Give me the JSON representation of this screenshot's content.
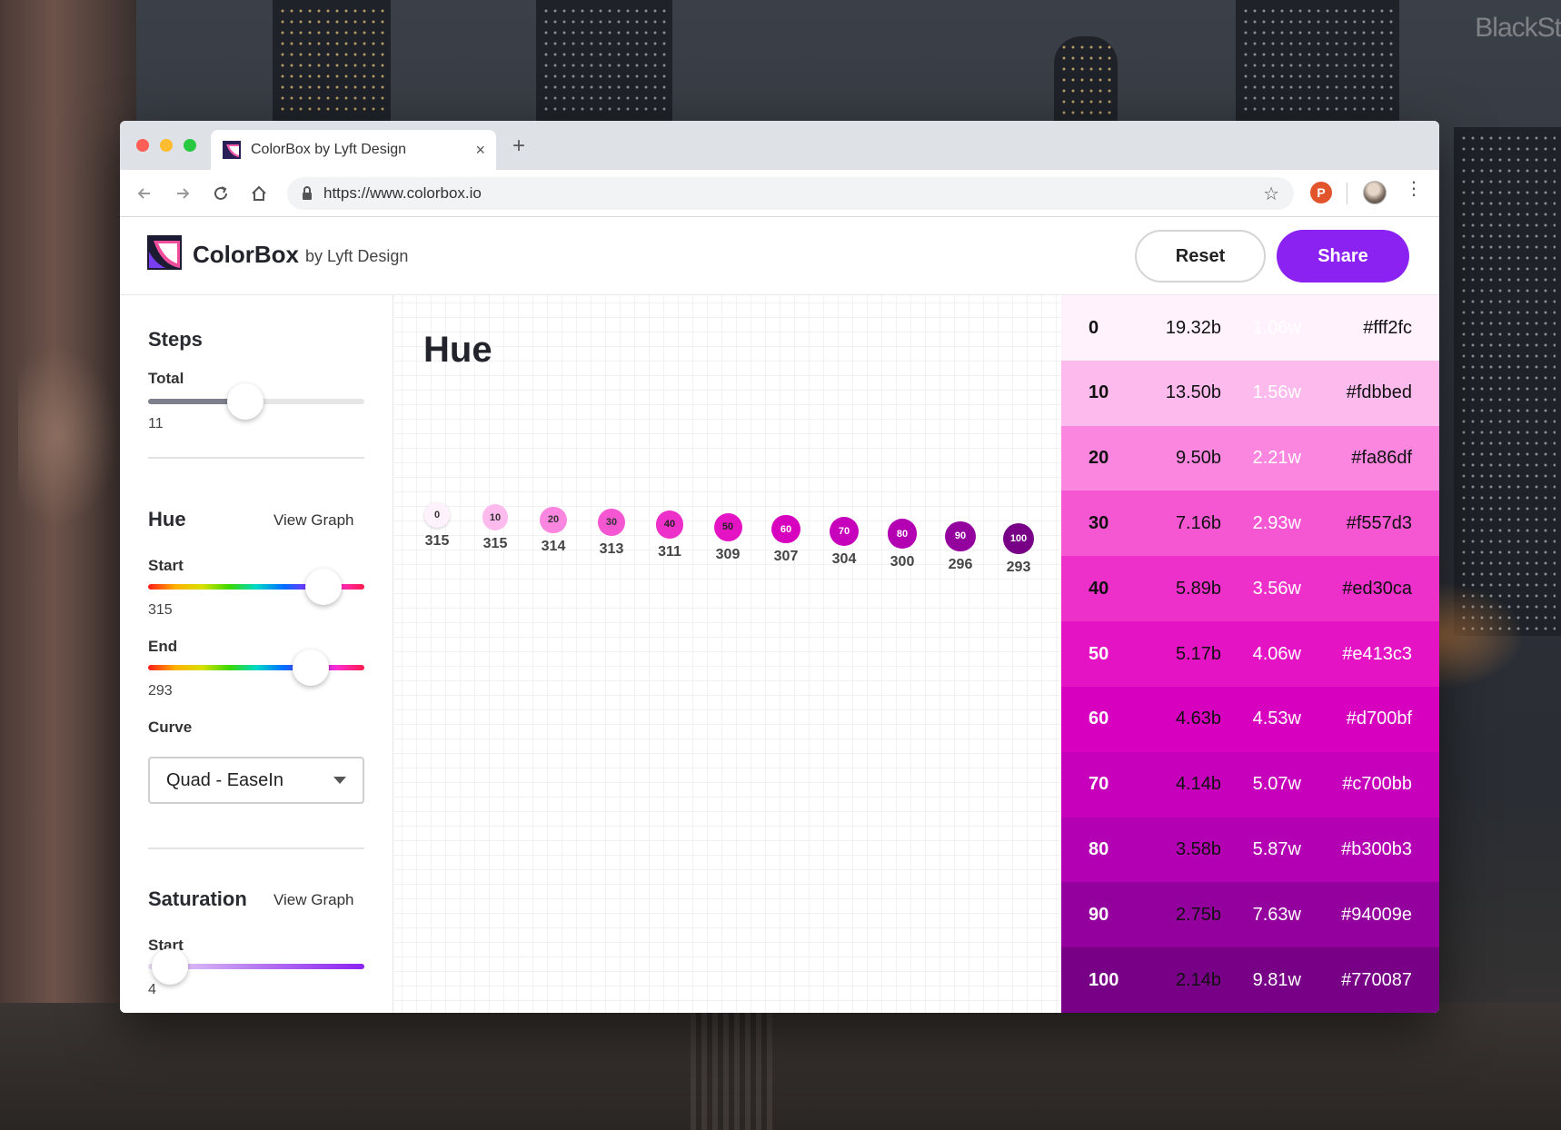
{
  "wallpaper": {
    "watermark": "BlackSt"
  },
  "browser": {
    "tab_title": "ColorBox by Lyft Design",
    "tab_close": "×",
    "new_tab": "+",
    "url": "https://www.colorbox.io",
    "extension_letter": "P"
  },
  "header": {
    "brand": "ColorBox",
    "byline": "by Lyft Design",
    "reset_label": "Reset",
    "share_label": "Share",
    "accent": "#8c22f2"
  },
  "sidebar": {
    "steps": {
      "heading": "Steps",
      "total_label": "Total",
      "total_value": "11",
      "slider_fraction": 0.45
    },
    "hue": {
      "heading": "Hue",
      "view_graph": "View Graph",
      "start_label": "Start",
      "start_value": "315",
      "start_fraction": 0.81,
      "end_label": "End",
      "end_value": "293",
      "end_fraction": 0.75,
      "curve_label": "Curve",
      "curve_value": "Quad - EaseIn"
    },
    "saturation": {
      "heading": "Saturation",
      "view_graph": "View Graph",
      "start_label": "Start",
      "start_value": "4",
      "start_fraction": 0.1
    }
  },
  "main": {
    "title": "Hue",
    "steps": [
      {
        "step": "0",
        "hue": "315",
        "color": "#fff2fc",
        "text": "#333"
      },
      {
        "step": "10",
        "hue": "315",
        "color": "#fdbbed",
        "text": "#333"
      },
      {
        "step": "20",
        "hue": "314",
        "color": "#fa86df",
        "text": "#333"
      },
      {
        "step": "30",
        "hue": "313",
        "color": "#f557d3",
        "text": "#333"
      },
      {
        "step": "40",
        "hue": "311",
        "color": "#ed30ca",
        "text": "#222"
      },
      {
        "step": "50",
        "hue": "309",
        "color": "#e413c3",
        "text": "#222"
      },
      {
        "step": "60",
        "hue": "307",
        "color": "#d700bf",
        "text": "#fff"
      },
      {
        "step": "70",
        "hue": "304",
        "color": "#c700bb",
        "text": "#fff"
      },
      {
        "step": "80",
        "hue": "300",
        "color": "#b300b3",
        "text": "#fff"
      },
      {
        "step": "90",
        "hue": "296",
        "color": "#94009e",
        "text": "#fff"
      },
      {
        "step": "100",
        "hue": "293",
        "color": "#770087",
        "text": "#fff"
      }
    ]
  },
  "swatches": [
    {
      "step": "0",
      "contrast_b": "19.32b",
      "contrast_w": "1.06w",
      "hex": "#fff2fc",
      "bg": "#fff2fc",
      "fg": "#111",
      "b_color": "#111",
      "w_color": "#ffffff"
    },
    {
      "step": "10",
      "contrast_b": "13.50b",
      "contrast_w": "1.56w",
      "hex": "#fdbbed",
      "bg": "#fdbbed",
      "fg": "#111",
      "b_color": "#111",
      "w_color": "#ffffff"
    },
    {
      "step": "20",
      "contrast_b": "9.50b",
      "contrast_w": "2.21w",
      "hex": "#fa86df",
      "bg": "#fa86df",
      "fg": "#111",
      "b_color": "#111",
      "w_color": "#ffffff"
    },
    {
      "step": "30",
      "contrast_b": "7.16b",
      "contrast_w": "2.93w",
      "hex": "#f557d3",
      "bg": "#f557d3",
      "fg": "#111",
      "b_color": "#111",
      "w_color": "#ffffff"
    },
    {
      "step": "40",
      "contrast_b": "5.89b",
      "contrast_w": "3.56w",
      "hex": "#ed30ca",
      "bg": "#ed30ca",
      "fg": "#111",
      "b_color": "#111",
      "w_color": "#ffffff"
    },
    {
      "step": "50",
      "contrast_b": "5.17b",
      "contrast_w": "4.06w",
      "hex": "#e413c3",
      "bg": "#e413c3",
      "fg": "#fff",
      "b_color": "#111",
      "w_color": "#ffffff"
    },
    {
      "step": "60",
      "contrast_b": "4.63b",
      "contrast_w": "4.53w",
      "hex": "#d700bf",
      "bg": "#d700bf",
      "fg": "#fff",
      "b_color": "#111",
      "w_color": "#ffffff"
    },
    {
      "step": "70",
      "contrast_b": "4.14b",
      "contrast_w": "5.07w",
      "hex": "#c700bb",
      "bg": "#c700bb",
      "fg": "#fff",
      "b_color": "#111",
      "w_color": "#ffffff"
    },
    {
      "step": "80",
      "contrast_b": "3.58b",
      "contrast_w": "5.87w",
      "hex": "#b300b3",
      "bg": "#b300b3",
      "fg": "#fff",
      "b_color": "#111",
      "w_color": "#ffffff"
    },
    {
      "step": "90",
      "contrast_b": "2.75b",
      "contrast_w": "7.63w",
      "hex": "#94009e",
      "bg": "#94009e",
      "fg": "#fff",
      "b_color": "#111",
      "w_color": "#ffffff"
    },
    {
      "step": "100",
      "contrast_b": "2.14b",
      "contrast_w": "9.81w",
      "hex": "#770087",
      "bg": "#770087",
      "fg": "#fff",
      "b_color": "#111",
      "w_color": "#ffffff"
    }
  ]
}
